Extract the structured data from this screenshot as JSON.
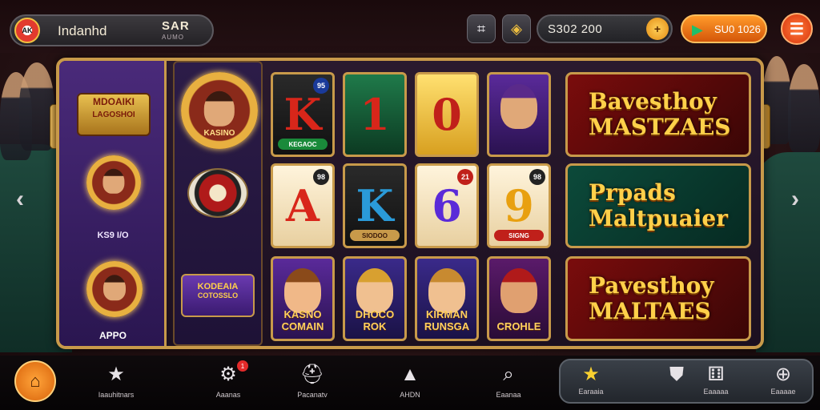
{
  "header": {
    "player_name": "Indanhd",
    "player_value": "SAR",
    "player_sub": "AUMO",
    "coins": "S302 200",
    "coins_plus_icon": "plus-icon",
    "gems": "SU0 1026",
    "menu_icon": "hamburger-icon"
  },
  "left_panel": {
    "top_emblem_title": "MDOAIKI",
    "top_emblem_sub": "LAGOSHOI",
    "mid_emblem_caption": "KS9 I/O",
    "bottom_label": "APPO"
  },
  "column2": {
    "badge_title": "KASINO",
    "card_title": "KODEAIA",
    "card_sub": "COTOSSLO"
  },
  "tiles": [
    {
      "glyph": "K",
      "tag": "KEGAOC",
      "badge": "95"
    },
    {
      "glyph": "1",
      "tag": "",
      "badge": ""
    },
    {
      "glyph": "0",
      "tag": "",
      "badge": ""
    },
    {
      "glyph": "",
      "tag": "",
      "badge": ""
    },
    {
      "glyph": "A",
      "tag": "",
      "badge": "98"
    },
    {
      "glyph": "K",
      "tag": "SIODOO",
      "badge": ""
    },
    {
      "glyph": "6",
      "tag": "",
      "badge": "21"
    },
    {
      "glyph": "9",
      "tag": "SIGNG",
      "badge": "98"
    },
    {
      "label": "KASNO COMAIN"
    },
    {
      "label": "DHOCO ROK"
    },
    {
      "label": "KIRMAN RUNSGA"
    },
    {
      "label": "CROHLE"
    }
  ],
  "banners": [
    {
      "line1": "Bavesthoy",
      "line2": "MASTZAES"
    },
    {
      "line1": "Prpads",
      "line2": "Maltpuaier"
    },
    {
      "line1": "Pavesthoy",
      "line2": "MALTAES"
    }
  ],
  "bottom_nav": {
    "items": [
      {
        "label": "Iaauhitnars",
        "icon": "star-icon"
      },
      {
        "label": "Aaanas",
        "icon": "gear-icon",
        "notification": "1"
      },
      {
        "label": "Pacanatv",
        "icon": "helmet-icon"
      },
      {
        "label": "AHDN",
        "icon": "triangle-icon"
      },
      {
        "label": "Eaanaa",
        "icon": "search-icon"
      }
    ],
    "quick": [
      {
        "label": "Earaaia",
        "icon": "star-icon"
      },
      {
        "label": "",
        "icon": "badge-icon"
      },
      {
        "label": "Eaaaaa",
        "icon": "dice-icon"
      },
      {
        "label": "Eaaaae",
        "icon": "compass-icon"
      }
    ]
  },
  "colors": {
    "accent_gold": "#c89a4a",
    "orange": "#d8620a",
    "purple": "#4a2a7a"
  }
}
